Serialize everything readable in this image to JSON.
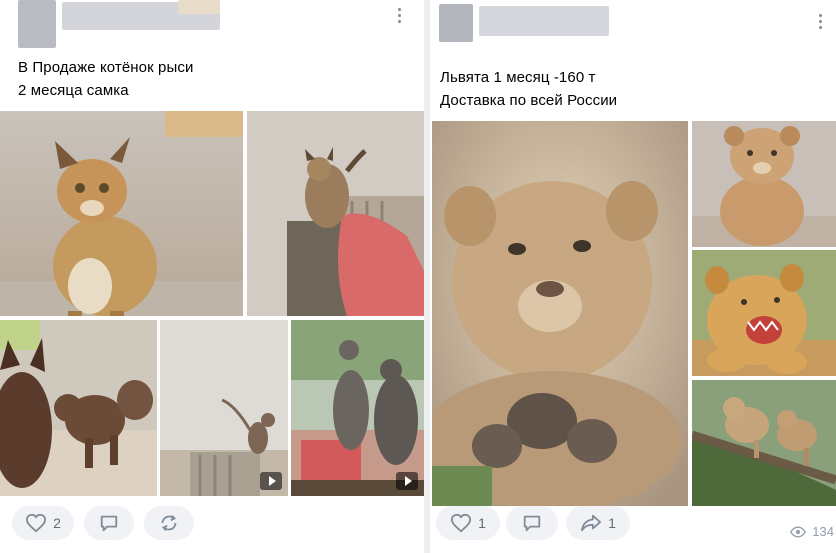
{
  "post1": {
    "text_line1": "В Продаже котёнок рыси",
    "text_line2": "2 месяца самка",
    "photos": [
      {
        "name": "lynx-kitten-sitting"
      },
      {
        "name": "lynx-kitten-on-sofa"
      },
      {
        "name": "sphynx-cats-and-lynx"
      },
      {
        "name": "lynx-kitten-on-floor",
        "video": true
      },
      {
        "name": "cats-at-window",
        "video": true
      }
    ],
    "likes": "2"
  },
  "post2": {
    "text_line1": "Львята 1 месяц -160 т",
    "text_line2": "Доставка по всей России",
    "photos": [
      {
        "name": "lion-cub-closeup"
      },
      {
        "name": "lion-cub-sitting"
      },
      {
        "name": "lion-cub-roaring"
      },
      {
        "name": "lion-cubs-on-branch"
      }
    ],
    "likes": "1",
    "shares": "1",
    "views": "134"
  },
  "colors": {
    "background": "#edeef0",
    "card": "#ffffff",
    "button_bg": "#f0f2f5",
    "icon": "#818c99",
    "count_text": "#626d7a",
    "views_text": "#939cb0"
  },
  "icons": [
    "more-icon",
    "heart-icon",
    "comment-icon",
    "repost-icon",
    "share-icon",
    "eye-icon",
    "play-icon"
  ]
}
